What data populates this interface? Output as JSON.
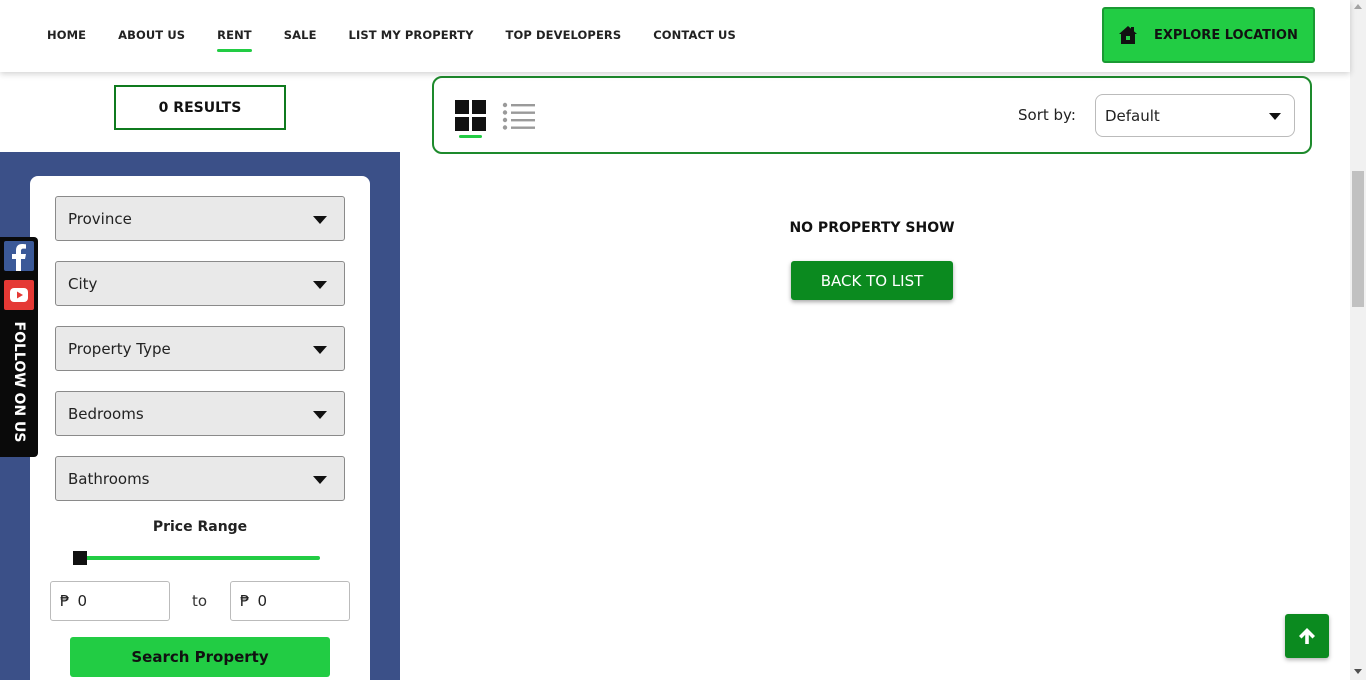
{
  "nav": {
    "items": [
      {
        "label": "HOME",
        "active": false
      },
      {
        "label": "ABOUT US",
        "active": false
      },
      {
        "label": "RENT",
        "active": true
      },
      {
        "label": "SALE",
        "active": false
      },
      {
        "label": "LIST MY PROPERTY",
        "active": false
      },
      {
        "label": "TOP DEVELOPERS",
        "active": false
      },
      {
        "label": "CONTACT US",
        "active": false
      }
    ],
    "explore_label": "EXPLORE LOCATION",
    "explore_icon": "house-icon"
  },
  "results": {
    "label": "0 RESULTS"
  },
  "filters": {
    "province": "Province",
    "city": "City",
    "property_type": "Property Type",
    "bedrooms": "Bedrooms",
    "bathrooms": "Bathrooms",
    "price_range_label": "Price Range",
    "price_slider_value": 0,
    "currency_symbol": "₱",
    "min_price": "0",
    "to_label": "to",
    "max_price": "0",
    "search_label": "Search Property"
  },
  "follow": {
    "label": "FOLLOW ON US",
    "icons": [
      "facebook-icon",
      "youtube-icon"
    ]
  },
  "toolbar": {
    "active_view": "grid",
    "sort_label": "Sort by:",
    "sort_value": "Default"
  },
  "empty_state": {
    "message": "NO PROPERTY SHOW",
    "back_label": "BACK TO LIST"
  },
  "colors": {
    "brand_green": "#22cc44",
    "dark_green": "#0b8a1f",
    "sidebar_blue": "#3b5088"
  }
}
